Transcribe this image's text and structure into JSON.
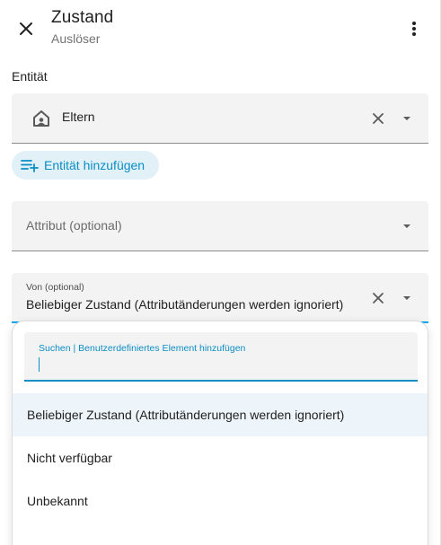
{
  "header": {
    "title": "Zustand",
    "subtitle": "Auslöser"
  },
  "entity_section": {
    "label": "Entität",
    "value": "Eltern",
    "add_button_label": "Entität hinzufügen"
  },
  "attribute_field": {
    "placeholder": "Attribut (optional)"
  },
  "from_field": {
    "label": "Von (optional)",
    "value": "Beliebiger Zustand (Attributänderungen werden ignoriert)"
  },
  "dropdown": {
    "search_label": "Suchen | Benutzerdefiniertes Element hinzufügen",
    "options": [
      "Beliebiger Zustand (Attributänderungen werden ignoriert)",
      "Nicht verfügbar",
      "Unbekannt"
    ]
  },
  "colors": {
    "accent": "#0a8ec4",
    "focus_line": "#03a9f4",
    "field_bg": "#f3f3f3",
    "chip_bg": "#e2f0f7",
    "selected_bg": "#eef5fa"
  }
}
